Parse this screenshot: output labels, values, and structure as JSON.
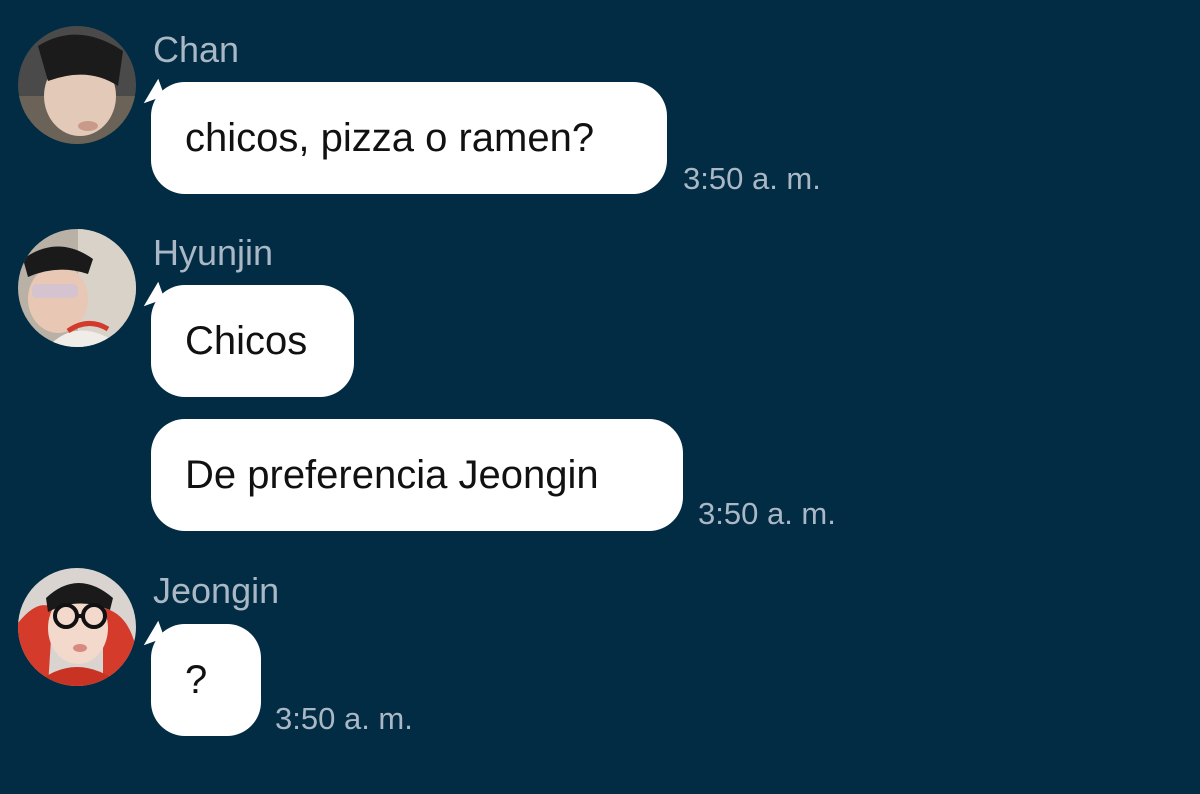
{
  "colors": {
    "background": "#022b44",
    "bubble": "#ffffff",
    "meta_text": "#a9b8c4"
  },
  "messages": [
    {
      "sender": "Chan",
      "avatar": "chan-avatar",
      "bubbles": [
        "chicos, pizza o ramen?"
      ],
      "time": "3:50 a. m."
    },
    {
      "sender": "Hyunjin",
      "avatar": "hyunjin-avatar",
      "bubbles": [
        "Chicos",
        "De preferencia Jeongin"
      ],
      "time": "3:50 a. m."
    },
    {
      "sender": "Jeongin",
      "avatar": "jeongin-avatar",
      "bubbles": [
        "?"
      ],
      "time": "3:50 a. m."
    }
  ]
}
